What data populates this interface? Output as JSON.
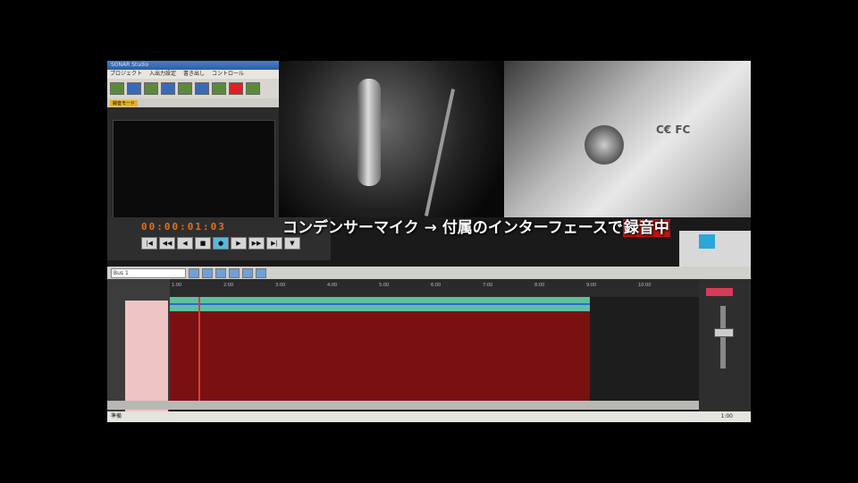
{
  "daw": {
    "window_title": "SONAR Studio",
    "menu": [
      "プロジェクト",
      "入出力設定",
      "書き出し",
      "コントロール"
    ],
    "record_tag": "録音モード",
    "counter": "00:00:01:03",
    "transport_buttons": [
      "|◀",
      "◀◀",
      "◀",
      "■",
      "●",
      "▶",
      "▶▶",
      "▶|",
      "▼"
    ]
  },
  "caption": {
    "text": "コンデンサーマイク → 付属のインターフェースで",
    "highlight": "録音中"
  },
  "track_view": {
    "track_select": "Bus 1",
    "ruler_ticks": [
      "1:00",
      "2:00",
      "3:00",
      "4:00",
      "5:00",
      "6:00",
      "7:00",
      "8:00",
      "9:00",
      "10:00"
    ],
    "status_left": "準備",
    "status_right": "1:00"
  }
}
